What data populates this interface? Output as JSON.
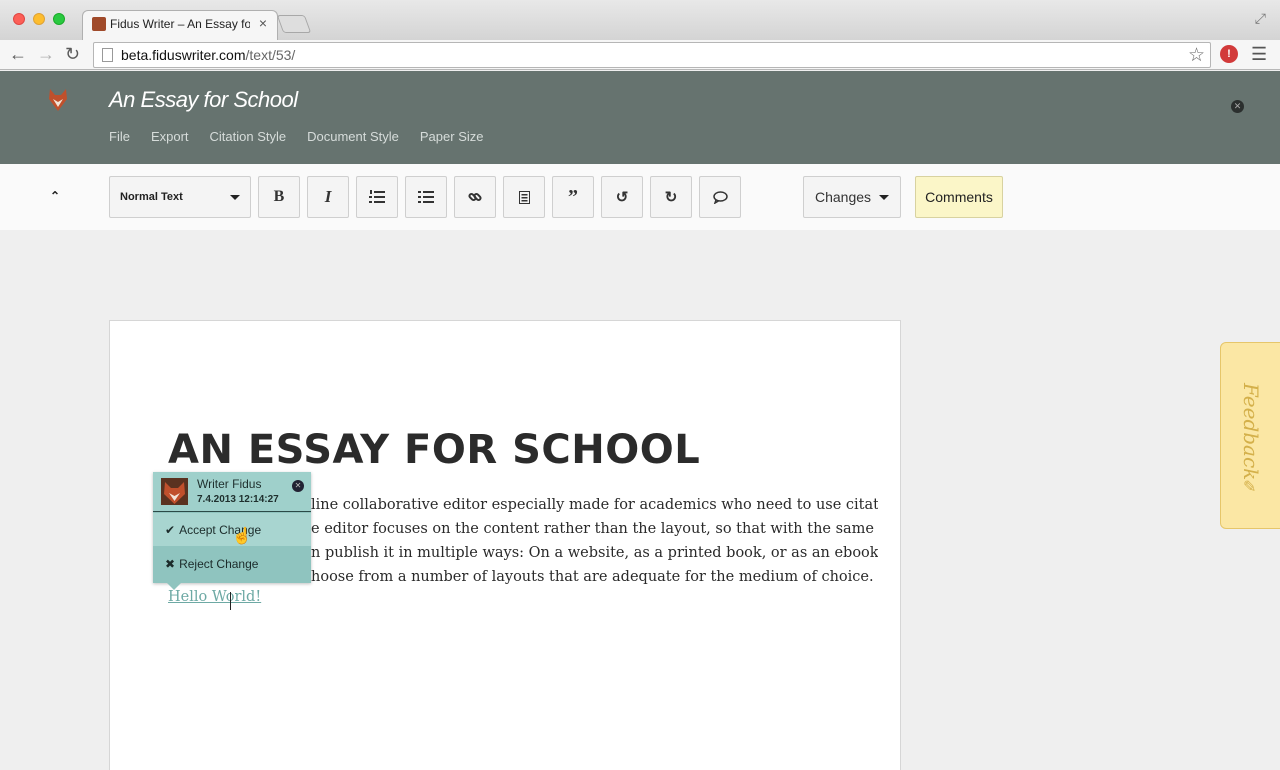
{
  "browser": {
    "tab_title": "Fidus Writer – An Essay for School",
    "url_host": "beta.fiduswriter.com",
    "url_path": "/text/53/"
  },
  "app": {
    "doc_title": "An Essay for School",
    "menu": [
      "File",
      "Export",
      "Citation Style",
      "Document Style",
      "Paper Size"
    ]
  },
  "toolbar": {
    "style_select": "Normal Text",
    "bold_label": "B",
    "italic_label": "I",
    "changes_label": "Changes",
    "comments_label": "Comments"
  },
  "document": {
    "heading": "AN ESSAY FOR SCHOOL",
    "lines": [
      "line collaborative editor especially made for academics who need to use citations",
      "e editor focuses on the content rather than the layout, so that with the same",
      "n publish it in multiple ways: On a website, as a printed book, or as an ebook. In",
      "hoose from a number of layouts that are adequate for the medium of choice."
    ],
    "inserted_text": "Hello World!"
  },
  "change_popup": {
    "author": "Writer Fidus",
    "date": "7.4.2013 12:14:27",
    "accept_label": "Accept Change",
    "reject_label": "Reject Change"
  },
  "feedback": {
    "label": "Feedback"
  },
  "colors": {
    "header_bg": "#66736f",
    "popup_bg": "#8fc4bf",
    "comments_bg": "#fbf6c8",
    "feedback_bg": "#fbe7a4"
  }
}
